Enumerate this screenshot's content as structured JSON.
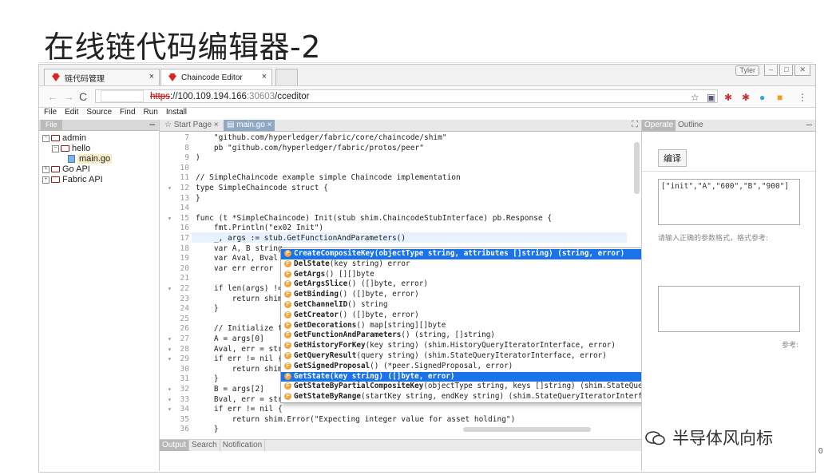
{
  "slide": {
    "title": "在线链代码编辑器-2",
    "page": "0"
  },
  "browser": {
    "tabs": [
      {
        "label": "链代码管理",
        "active": false
      },
      {
        "label": "Chaincode Editor",
        "active": true
      }
    ],
    "window_user": "Tyler",
    "url": {
      "scheme": "https",
      "host": "://100.109.194.166",
      "port": ":30603",
      "path": "/cceditor"
    }
  },
  "menu": [
    "File",
    "Edit",
    "Source",
    "Find",
    "Run",
    "Install"
  ],
  "left_panel": {
    "header": "File",
    "tree": [
      {
        "label": "admin",
        "level": 0,
        "type": "folder"
      },
      {
        "label": "hello",
        "level": 1,
        "type": "folder"
      },
      {
        "label": "main.go",
        "level": 2,
        "type": "file",
        "selected": true
      },
      {
        "label": "Go API",
        "level": 0,
        "type": "folder"
      },
      {
        "label": "Fabric API",
        "level": 0,
        "type": "folder"
      }
    ]
  },
  "editor": {
    "tabs": [
      "Start Page",
      "main.go"
    ],
    "lines": [
      {
        "n": "7",
        "text": "    \"github.com/hyperledger/fabric/core/chaincode/shim\""
      },
      {
        "n": "8",
        "text": "    pb \"github.com/hyperledger/fabric/protos/peer\""
      },
      {
        "n": "9",
        "text": ")"
      },
      {
        "n": "10",
        "text": ""
      },
      {
        "n": "11",
        "text": "// SimpleChaincode example simple Chaincode implementation"
      },
      {
        "n": "12",
        "text": "type SimpleChaincode struct {",
        "fold": true
      },
      {
        "n": "13",
        "text": "}"
      },
      {
        "n": "14",
        "text": ""
      },
      {
        "n": "15",
        "text": "func (t *SimpleChaincode) Init(stub shim.ChaincodeStubInterface) pb.Response {",
        "fold": true
      },
      {
        "n": "16",
        "text": "    fmt.Println(\"ex02 Init\")"
      },
      {
        "n": "17",
        "text": "    _, args := stub.GetFunctionAndParameters()"
      },
      {
        "n": "18",
        "text": "    var A, B string"
      },
      {
        "n": "19",
        "text": "    var Aval, Bval i"
      },
      {
        "n": "20",
        "text": "    var err error"
      },
      {
        "n": "21",
        "text": ""
      },
      {
        "n": "22",
        "text": "    if len(args) !=",
        "fold": true
      },
      {
        "n": "23",
        "text": "        return shim."
      },
      {
        "n": "24",
        "text": "    }"
      },
      {
        "n": "25",
        "text": ""
      },
      {
        "n": "26",
        "text": "    // Initialize th"
      },
      {
        "n": "27",
        "text": "    A = args[0]",
        "fold": true
      },
      {
        "n": "28",
        "text": "    Aval, err = strc",
        "fold": true
      },
      {
        "n": "29",
        "text": "    if err != nil {",
        "fold": true
      },
      {
        "n": "30",
        "text": "        return shim."
      },
      {
        "n": "31",
        "text": "    }"
      },
      {
        "n": "32",
        "text": "    B = args[2]",
        "fold": true
      },
      {
        "n": "33",
        "text": "    Bval, err = strconv.Atoi(args[3])",
        "fold": true
      },
      {
        "n": "34",
        "text": "    if err != nil {",
        "fold": true
      },
      {
        "n": "35",
        "text": "        return shim.Error(\"Expecting integer value for asset holding\")"
      },
      {
        "n": "36",
        "text": "    }"
      }
    ],
    "bottom_tabs": [
      "Output",
      "Search",
      "Notification"
    ]
  },
  "autocomplete": [
    {
      "name": "CreateCompositeKey",
      "sig": "(objectType string, attributes []string) (string, error)",
      "selected": true
    },
    {
      "name": "DelState",
      "sig": "(key string) error"
    },
    {
      "name": "GetArgs",
      "sig": "() [][]byte"
    },
    {
      "name": "GetArgsSlice",
      "sig": "() ([]byte, error)"
    },
    {
      "name": "GetBinding",
      "sig": "() ([]byte, error)"
    },
    {
      "name": "GetChannelID",
      "sig": "() string"
    },
    {
      "name": "GetCreator",
      "sig": "() ([]byte, error)"
    },
    {
      "name": "GetDecorations",
      "sig": "() map[string][]byte"
    },
    {
      "name": "GetFunctionAndParameters",
      "sig": "() (string, []string)"
    },
    {
      "name": "GetHistoryForKey",
      "sig": "(key string) (shim.HistoryQueryIteratorInterface, error)"
    },
    {
      "name": "GetQueryResult",
      "sig": "(query string) (shim.StateQueryIteratorInterface, error)"
    },
    {
      "name": "GetSignedProposal",
      "sig": "() (*peer.SignedProposal, error)"
    },
    {
      "name": "GetState",
      "sig": "(key string) ([]byte, error)",
      "selected": true
    },
    {
      "name": "GetStateByPartialCompositeKey",
      "sig": "(objectType string, keys []string) (shim.StateQueryIteratorInterface, error)"
    },
    {
      "name": "GetStateByRange",
      "sig": "(startKey string, endKey string) (shim.StateQueryIteratorInterface, error)"
    }
  ],
  "right_panel": {
    "tabs": [
      "Operate",
      "Outline"
    ],
    "compile_label": "编译",
    "args_value": "[\"init\",\"A\",\"600\",\"B\",\"900\"]",
    "args_hint": "请输入正确的参数格式，格式参考:",
    "hint2": "参考:"
  },
  "watermark": "半导体风向标",
  "colors": {
    "selection": "#1a73e8",
    "fold_icon": "#f0a43a",
    "folder": "#8b1a1a"
  }
}
